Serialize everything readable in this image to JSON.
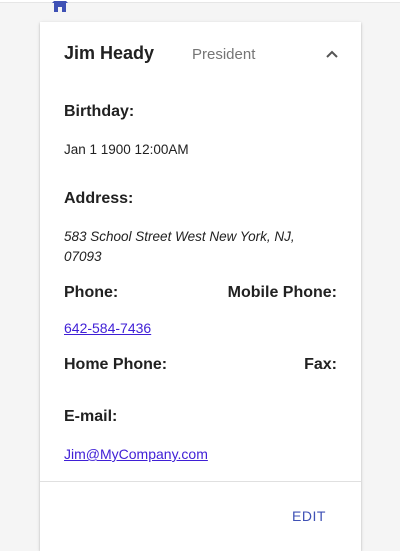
{
  "card": {
    "name": "Jim Heady",
    "title": "President",
    "edit_label": "EDIT"
  },
  "fields": {
    "birthday_label": "Birthday:",
    "birthday_value": "Jan 1 1900 12:00AM",
    "address_label": "Address:",
    "address_value": "583 School Street West New York, NJ, 07093",
    "phone_label": "Phone:",
    "phone_value": "642-584-7436",
    "mobile_phone_label": "Mobile Phone:",
    "home_phone_label": "Home Phone:",
    "fax_label": "Fax:",
    "email_label": "E-mail:",
    "email_value": "Jim@MyCompany.com"
  },
  "icons": {
    "top": "home-icon",
    "collapse": "chevron-up-icon"
  },
  "colors": {
    "link": "#3f1fd6",
    "accent": "#3f51b5",
    "muted": "#757575"
  }
}
